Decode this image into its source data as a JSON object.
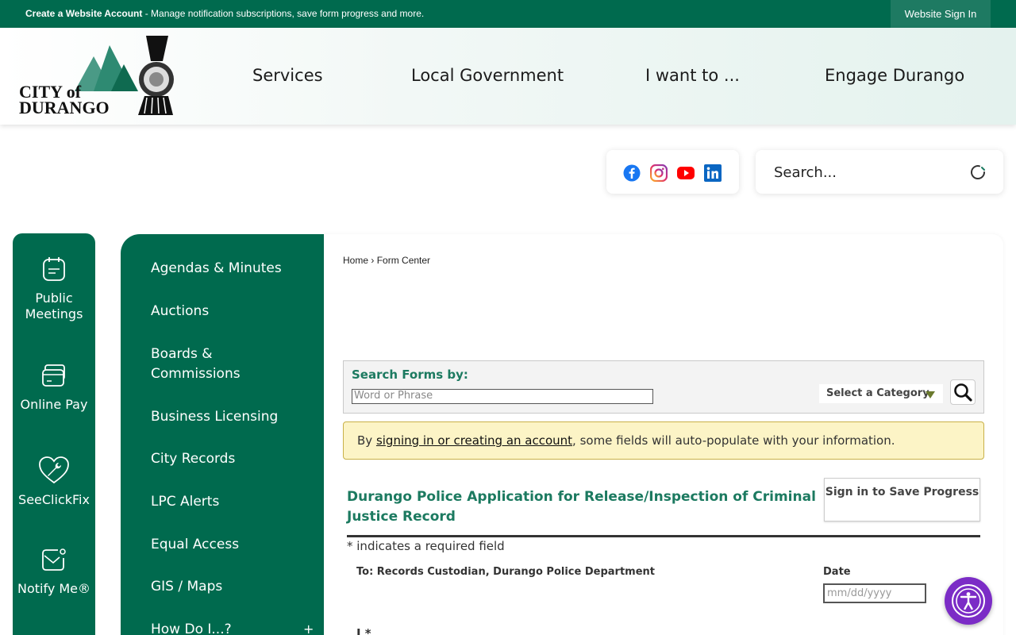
{
  "topbar": {
    "create_account": "Create a Website Account",
    "message": " - Manage notification subscriptions, save form progress and more.",
    "sign_in": "Website Sign In"
  },
  "header": {
    "logo_alt_line1": "CITY of",
    "logo_alt_line2": "DURANGO",
    "nav": [
      "Services",
      "Local Government",
      "I want to ...",
      "Engage Durango"
    ]
  },
  "social": {
    "icons": [
      "facebook-icon",
      "instagram-icon",
      "youtube-icon",
      "linkedin-icon"
    ],
    "colors": {
      "facebook": "#1877f2",
      "instagram": "#d6249f",
      "youtube": "#ff0000",
      "linkedin": "#0a66c2"
    }
  },
  "search": {
    "placeholder": "Search..."
  },
  "quick_links": [
    "Public Meetings",
    "Online Pay",
    "SeeClickFix",
    "Notify Me®"
  ],
  "sidebar": {
    "items": [
      "Agendas & Minutes",
      "Auctions",
      "Boards & Commissions",
      "Business Licensing",
      "City Records",
      "LPC Alerts",
      "Equal Access",
      "GIS / Maps",
      "How Do I...?"
    ],
    "expand_symbol": "+"
  },
  "breadcrumb": {
    "home": "Home",
    "separator": "›",
    "current": "Form Center"
  },
  "search_forms": {
    "label": "Search Forms by:",
    "placeholder": "Word or Phrase",
    "category": "Select a Category"
  },
  "notice": {
    "prefix": "By ",
    "link": "signing in or creating an account",
    "suffix": ", some fields will auto-populate with your information."
  },
  "form": {
    "title": "Durango Police Application for Release/Inspection of Criminal Justice Record",
    "save_button": "Sign in to Save Progress",
    "required_note": "* indicates a required field",
    "to_line": "To: Records Custodian, Durango Police Department",
    "date_label": "Date",
    "date_placeholder": "mm/dd/yyyy",
    "i_label": "I *"
  },
  "colors": {
    "brand_green": "#006a4e",
    "accent_purple": "#7b2cc6",
    "notice_bg": "#fcf4c6"
  }
}
